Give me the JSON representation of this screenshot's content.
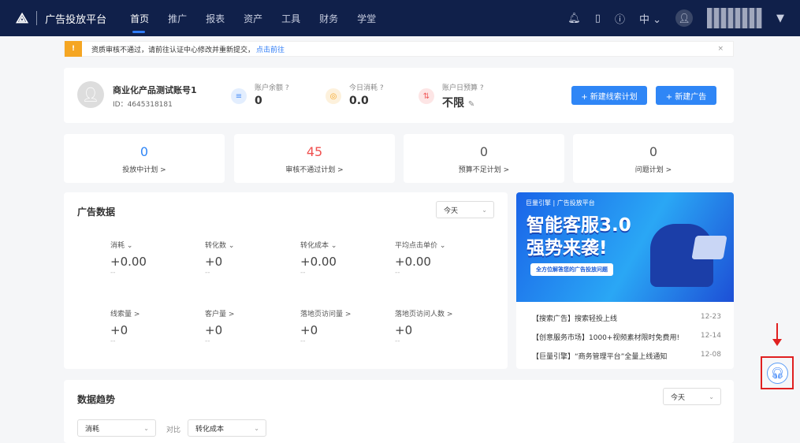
{
  "header": {
    "logo_icon": "ocean-engine-logo",
    "brand": "广告投放平台",
    "nav": [
      "首页",
      "推广",
      "报表",
      "资产",
      "工具",
      "财务",
      "学堂"
    ],
    "active_nav": "首页",
    "lang": "中",
    "icons": [
      "bell-icon",
      "mobile-icon",
      "help-icon",
      "user-icon",
      "caret-down-icon"
    ]
  },
  "alert": {
    "text": "资质审核不通过，请前往认证中心修改并重新提交，",
    "link": "点击前往",
    "close": "×"
  },
  "account": {
    "name": "商业化产品测试账号1",
    "id": "ID：4645318181",
    "metrics": [
      {
        "label": "账户余额",
        "value": "0",
        "color": "#4a8ff7"
      },
      {
        "label": "今日消耗",
        "value": "0.0",
        "color": "#f5a623"
      },
      {
        "label": "账户日预算",
        "value": "不限",
        "color": "#f05a5a"
      }
    ],
    "buttons": [
      "+ 新建线索计划",
      "+ 新建广告"
    ]
  },
  "stats": [
    {
      "value": "0",
      "label": "投放中计划 >",
      "color": "#2f86f6"
    },
    {
      "value": "45",
      "label": "审核不通过计划 >",
      "color": "#f0504f"
    },
    {
      "value": "0",
      "label": "预算不足计划 >",
      "color": "#555555"
    },
    {
      "value": "0",
      "label": "问题计划 >",
      "color": "#555555"
    }
  ],
  "ad_data": {
    "title": "广告数据",
    "range": "今天",
    "cells": [
      {
        "label": "消耗 ⌄",
        "value": "+0.00",
        "delta": "--"
      },
      {
        "label": "转化数 ⌄",
        "value": "+0",
        "delta": "--"
      },
      {
        "label": "转化成本 ⌄",
        "value": "+0.00",
        "delta": "--"
      },
      {
        "label": "平均点击单价 ⌄",
        "value": "+0.00",
        "delta": "--"
      },
      {
        "label": "线索量 >",
        "value": "+0",
        "delta": "--"
      },
      {
        "label": "客户量 >",
        "value": "+0",
        "delta": "--"
      },
      {
        "label": "落地页访问量 >",
        "value": "+0",
        "delta": "--"
      },
      {
        "label": "落地页访问人数 >",
        "value": "+0",
        "delta": "--"
      }
    ]
  },
  "banner": {
    "brand": "巨量引擎 | 广告投放平台",
    "line1": "智能客服3.0",
    "line2": "强势来袭!",
    "tag": "全方位解答您的广告投放问题"
  },
  "news": [
    {
      "title": "【搜索广告】搜索轻投上线",
      "date": "12-23"
    },
    {
      "title": "【创意服务市场】1000+视频素材限时免费用!",
      "date": "12-14"
    },
    {
      "title": "【巨量引擎】“商务管理平台”全量上线通知",
      "date": "12-08"
    }
  ],
  "trend": {
    "title": "数据趋势",
    "range": "今天",
    "metric": "消耗",
    "compare_label": "对比",
    "compare_metric": "转化成本"
  },
  "help": {
    "icon": "headset-icon"
  }
}
